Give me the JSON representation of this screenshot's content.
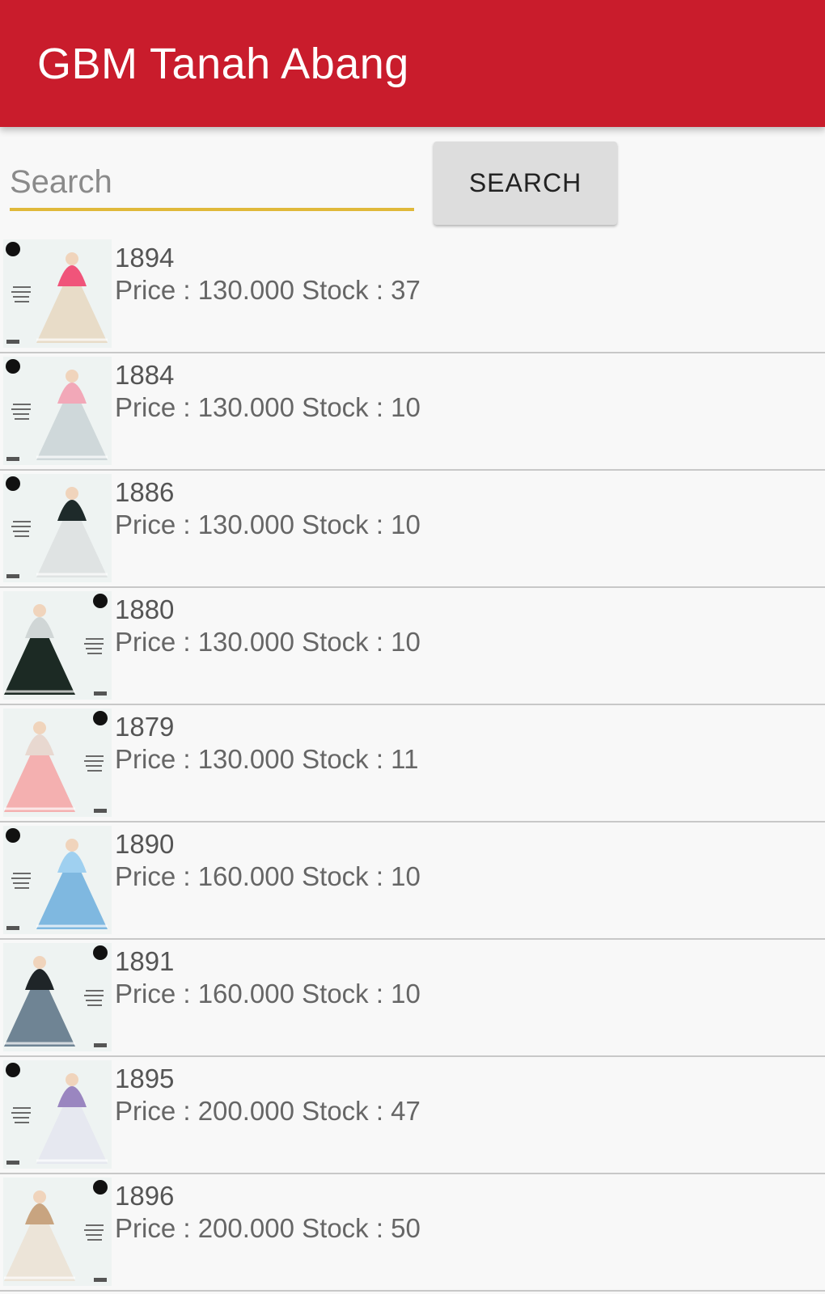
{
  "app": {
    "title": "GBM Tanah Abang",
    "accent_color": "#c91c2c",
    "input_accent_color": "#e0b93a"
  },
  "search": {
    "placeholder": "Search",
    "value": "",
    "button_label": "SEARCH"
  },
  "products": [
    {
      "code": "1894",
      "info": "Price : 130.000 Stock : 37",
      "dress_color": "#e8dcc8",
      "hijab_color": "#f0547a",
      "dot_side": "left"
    },
    {
      "code": "1884",
      "info": "Price : 130.000 Stock : 10",
      "dress_color": "#cfd8da",
      "hijab_color": "#f2a8b8",
      "dot_side": "left"
    },
    {
      "code": "1886",
      "info": "Price : 130.000 Stock : 10",
      "dress_color": "#dfe3e3",
      "hijab_color": "#1e2a2a",
      "dot_side": "left"
    },
    {
      "code": "1880",
      "info": "Price : 130.000 Stock : 10",
      "dress_color": "#1c2a24",
      "hijab_color": "#d0d6d6",
      "dot_side": "right"
    },
    {
      "code": "1879",
      "info": "Price : 130.000 Stock : 11",
      "dress_color": "#f4b0b0",
      "hijab_color": "#e8d8d0",
      "dot_side": "right"
    },
    {
      "code": "1890",
      "info": "Price : 160.000 Stock : 10",
      "dress_color": "#7fb8e0",
      "hijab_color": "#9fd0f0",
      "dot_side": "left"
    },
    {
      "code": "1891",
      "info": "Price : 160.000 Stock : 10",
      "dress_color": "#6f8494",
      "hijab_color": "#1f2528",
      "dot_side": "right"
    },
    {
      "code": "1895",
      "info": "Price : 200.000 Stock : 47",
      "dress_color": "#e6e8f0",
      "hijab_color": "#9a86c0",
      "dot_side": "left"
    },
    {
      "code": "1896",
      "info": "Price : 200.000 Stock : 50",
      "dress_color": "#ece4d8",
      "hijab_color": "#c8a480",
      "dot_side": "right"
    }
  ]
}
